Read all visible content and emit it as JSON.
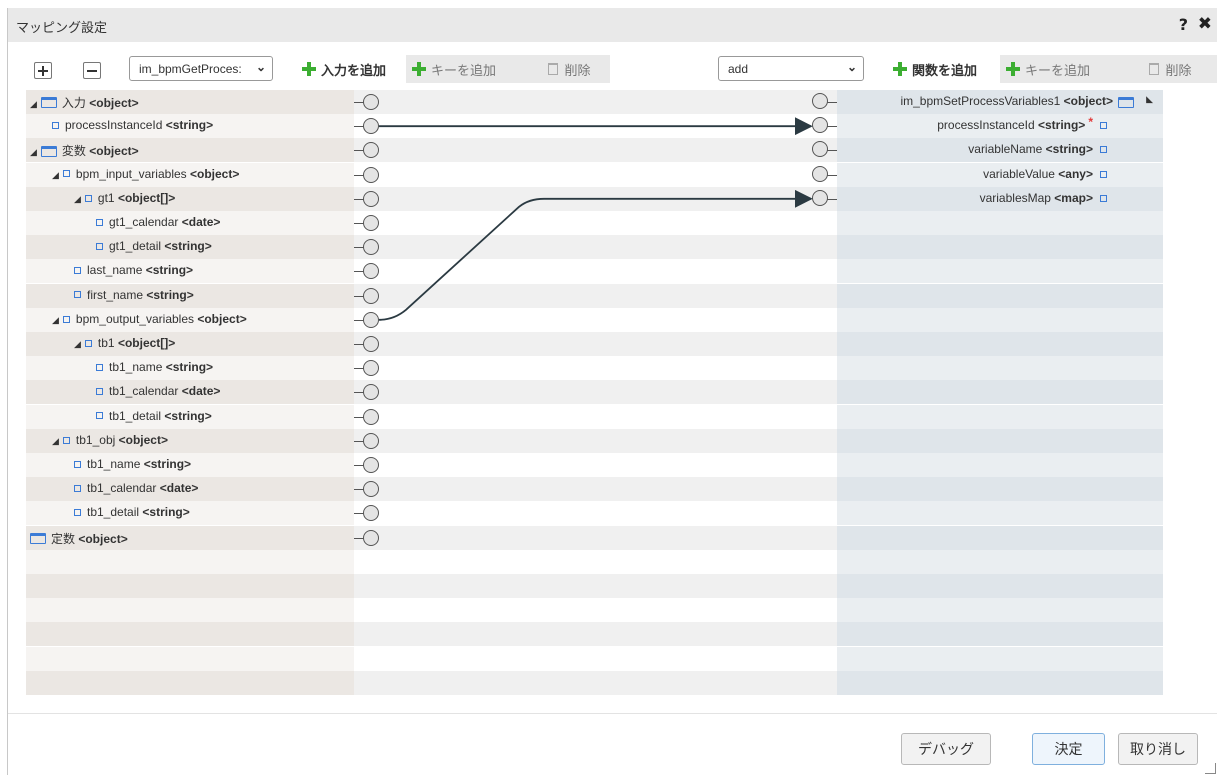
{
  "window": {
    "title": "マッピング設定",
    "help": "?",
    "close": "✖"
  },
  "toolbar": {
    "expand_label": "+",
    "collapse_label": "−",
    "input_select_value": "im_bpmGetProces:",
    "add_input": "入力を追加",
    "add_key_left": "キーを追加",
    "delete_left": "削除",
    "function_select_value": "add",
    "add_function": "関数を追加",
    "add_key_right": "キーを追加",
    "delete_right": "削除"
  },
  "left_tree": [
    {
      "name": "入力",
      "type": "<object>",
      "depth": 0,
      "kind": "folder",
      "expand": true
    },
    {
      "name": "processInstanceId",
      "type": "<string>",
      "depth": 1,
      "kind": "leaf",
      "expand": false
    },
    {
      "name": "変数",
      "type": "<object>",
      "depth": 0,
      "kind": "folder",
      "expand": true
    },
    {
      "name": "bpm_input_variables",
      "type": "<object>",
      "depth": 1,
      "kind": "leaf",
      "expand": true
    },
    {
      "name": "gt1",
      "type": "<object[]>",
      "depth": 2,
      "kind": "leaf",
      "expand": true
    },
    {
      "name": "gt1_calendar",
      "type": "<date>",
      "depth": 3,
      "kind": "leaf",
      "expand": false
    },
    {
      "name": "gt1_detail",
      "type": "<string>",
      "depth": 3,
      "kind": "leaf",
      "expand": false
    },
    {
      "name": "last_name",
      "type": "<string>",
      "depth": 2,
      "kind": "leaf",
      "expand": false
    },
    {
      "name": "first_name",
      "type": "<string>",
      "depth": 2,
      "kind": "leaf",
      "expand": false
    },
    {
      "name": "bpm_output_variables",
      "type": "<object>",
      "depth": 1,
      "kind": "leaf",
      "expand": true
    },
    {
      "name": "tb1",
      "type": "<object[]>",
      "depth": 2,
      "kind": "leaf",
      "expand": true
    },
    {
      "name": "tb1_name",
      "type": "<string>",
      "depth": 3,
      "kind": "leaf",
      "expand": false
    },
    {
      "name": "tb1_calendar",
      "type": "<date>",
      "depth": 3,
      "kind": "leaf",
      "expand": false
    },
    {
      "name": "tb1_detail",
      "type": "<string>",
      "depth": 3,
      "kind": "leaf",
      "expand": false
    },
    {
      "name": "tb1_obj",
      "type": "<object>",
      "depth": 1,
      "kind": "leaf",
      "expand": true
    },
    {
      "name": "tb1_name",
      "type": "<string>",
      "depth": 2,
      "kind": "leaf",
      "expand": false
    },
    {
      "name": "tb1_calendar",
      "type": "<date>",
      "depth": 2,
      "kind": "leaf",
      "expand": false
    },
    {
      "name": "tb1_detail",
      "type": "<string>",
      "depth": 2,
      "kind": "leaf",
      "expand": false
    },
    {
      "name": "定数",
      "type": "<object>",
      "depth": 0,
      "kind": "folder",
      "expand": false
    }
  ],
  "right_tree": [
    {
      "name": "im_bpmSetProcessVariables1",
      "type": "<object>",
      "kind": "folder",
      "required": false
    },
    {
      "name": "processInstanceId",
      "type": "<string>",
      "kind": "leaf",
      "required": true
    },
    {
      "name": "variableName",
      "type": "<string>",
      "kind": "leaf",
      "required": false
    },
    {
      "name": "variableValue",
      "type": "<any>",
      "kind": "leaf",
      "required": false
    },
    {
      "name": "variablesMap",
      "type": "<map>",
      "kind": "leaf",
      "required": false
    }
  ],
  "required_mark": "*",
  "mappings": [
    {
      "from": "processInstanceId",
      "to": "processInstanceId"
    },
    {
      "from": "bpm_output_variables",
      "to": "variablesMap"
    }
  ],
  "footer": {
    "debug": "デバッグ",
    "ok": "決定",
    "cancel": "取り消し"
  }
}
